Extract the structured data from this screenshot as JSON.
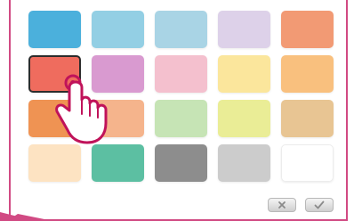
{
  "palette": {
    "rows": [
      [
        {
          "color": "#4bb0dc"
        },
        {
          "color": "#93cfe4"
        },
        {
          "color": "#a9d4e5"
        },
        {
          "color": "#ddd1e9"
        },
        {
          "color": "#f29a74"
        }
      ],
      [
        {
          "color": "#ef6c5e",
          "selected": true
        },
        {
          "color": "#d99ad0"
        },
        {
          "color": "#f4c0ce"
        },
        {
          "color": "#fbe69c"
        },
        {
          "color": "#f9c07e"
        }
      ],
      [
        {
          "color": "#ef9353"
        },
        {
          "color": "#f5b48c"
        },
        {
          "color": "#c6e4b5"
        },
        {
          "color": "#eaed96"
        },
        {
          "color": "#e8c593"
        }
      ],
      [
        {
          "color": "#fde3c2"
        },
        {
          "color": "#5cbfa2"
        },
        {
          "color": "#8d8d8d"
        },
        {
          "color": "#cccccc"
        },
        {
          "color": "#ffffff"
        }
      ]
    ]
  },
  "actions": {
    "cancel_icon": "close-icon",
    "confirm_icon": "check-icon"
  },
  "colors": {
    "frame": "#d14a83",
    "pointer_outline": "#c0135a",
    "pointer_fill": "#ffffff",
    "selection_border": "#2c2c2c"
  },
  "cursor": {
    "icon": "hand-pointer-icon"
  }
}
